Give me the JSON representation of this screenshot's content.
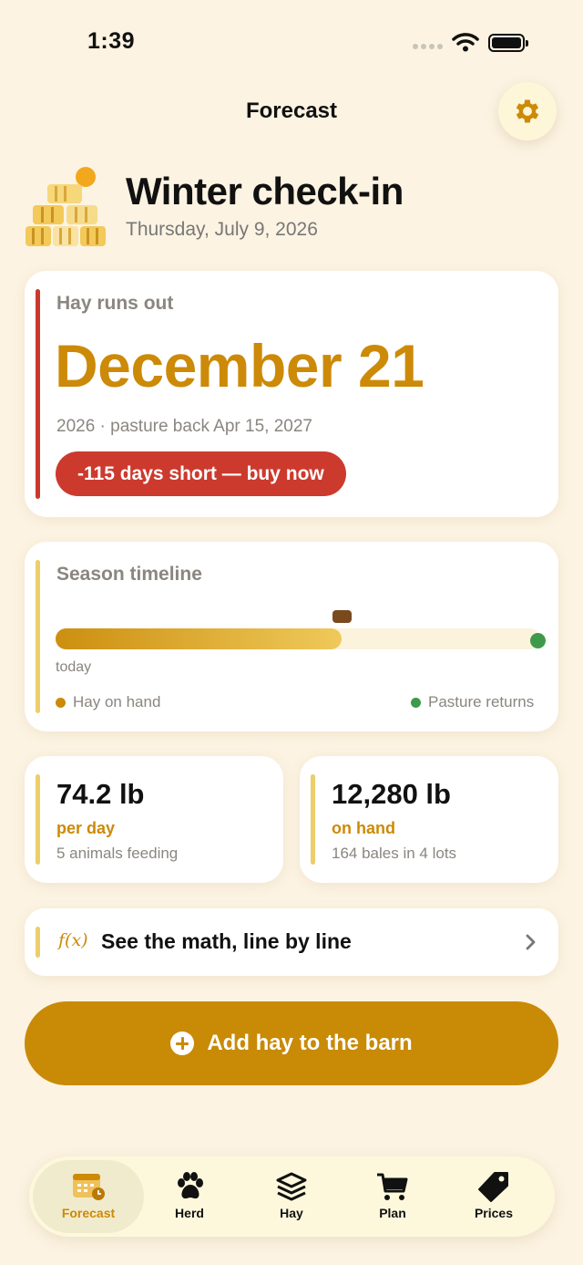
{
  "status_bar": {
    "time": "1:39"
  },
  "header": {
    "title": "Forecast",
    "settings_icon": "gear-icon"
  },
  "hero": {
    "title": "Winter check-in",
    "date": "Thursday, July 9, 2026",
    "art_icon": "hay-bales-icon"
  },
  "runout": {
    "label": "Hay runs out",
    "date": "December 21",
    "subtitle": "2026 · pasture back Apr 15, 2027",
    "alert": "-115 days short — buy now",
    "accent_color": "#c93a2c"
  },
  "timeline": {
    "label": "Season timeline",
    "today_label": "today",
    "hay_progress_fraction": 0.59,
    "marker_fraction": 0.59,
    "legend": [
      {
        "label": "Hay on hand",
        "color": "#cc8a08"
      },
      {
        "label": "Pasture returns",
        "color": "#3e9a4a"
      }
    ]
  },
  "stats": [
    {
      "value": "74.2 lb",
      "unit": "per day",
      "sub": "5 animals feeding"
    },
    {
      "value": "12,280 lb",
      "unit": "on hand",
      "sub": "164 bales in 4 lots"
    }
  ],
  "math": {
    "icon_text": "f(x)",
    "label": "See the math, line by line"
  },
  "primary_button": {
    "label": "Add hay to the barn"
  },
  "tabs": [
    {
      "label": "Forecast",
      "icon": "calendar-clock-icon",
      "active": true
    },
    {
      "label": "Herd",
      "icon": "paw-icon",
      "active": false
    },
    {
      "label": "Hay",
      "icon": "layers-icon",
      "active": false
    },
    {
      "label": "Plan",
      "icon": "cart-icon",
      "active": false
    },
    {
      "label": "Prices",
      "icon": "tag-icon",
      "active": false
    }
  ],
  "colors": {
    "background": "#fcf3e2",
    "accent": "#cc8a08",
    "alert": "#cc3a2e"
  }
}
